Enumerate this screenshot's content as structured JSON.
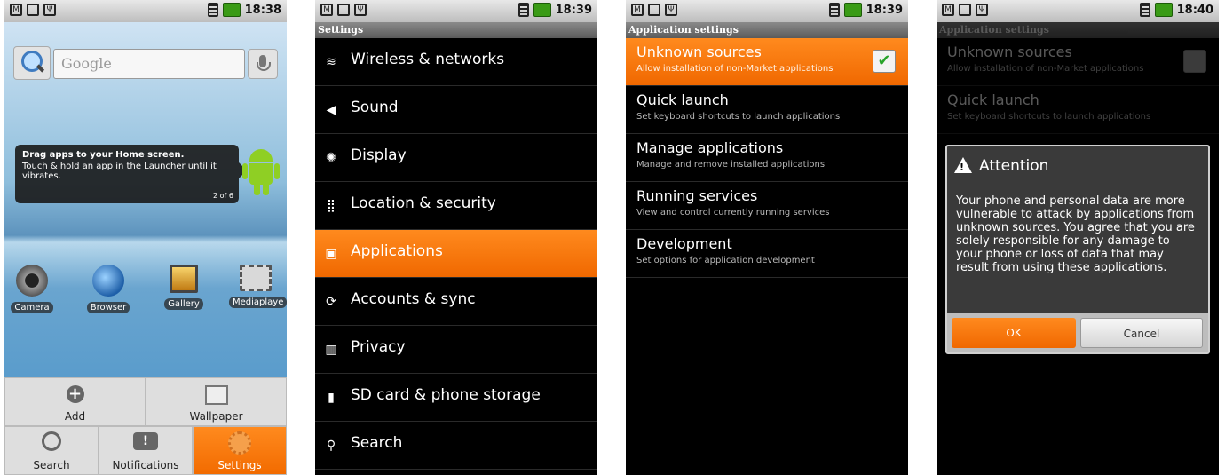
{
  "screens": [
    {
      "time": "18:38",
      "search": {
        "placeholder": "Google"
      },
      "tip": {
        "title": "Drag apps to your Home screen.",
        "body": "Touch & hold an app in the Launcher until it vibrates.",
        "page": "2 of 6"
      },
      "apps": [
        {
          "label": "Camera",
          "icon": "camera-icon"
        },
        {
          "label": "Browser",
          "icon": "globe-icon"
        },
        {
          "label": "Gallery",
          "icon": "gallery-icon"
        },
        {
          "label": "Mediaplaye",
          "icon": "film-icon"
        }
      ],
      "drawer": {
        "add": "Add",
        "wallpaper": "Wallpaper",
        "search": "Search",
        "notifications": "Notifications",
        "settings": "Settings"
      }
    },
    {
      "time": "18:39",
      "title": "Settings",
      "items": [
        {
          "label": "Wireless & networks",
          "icon": "wifi-icon",
          "glyph": "≋"
        },
        {
          "label": "Sound",
          "icon": "speaker-icon",
          "glyph": "◀"
        },
        {
          "label": "Display",
          "icon": "brightness-icon",
          "glyph": "✺"
        },
        {
          "label": "Location & security",
          "icon": "grid-icon",
          "glyph": "⣿"
        },
        {
          "label": "Applications",
          "icon": "applications-icon",
          "glyph": "▣",
          "selected": true
        },
        {
          "label": "Accounts & sync",
          "icon": "sync-icon",
          "glyph": "⟳"
        },
        {
          "label": "Privacy",
          "icon": "privacy-icon",
          "glyph": "▥"
        },
        {
          "label": "SD card & phone storage",
          "icon": "sdcard-icon",
          "glyph": "▮"
        },
        {
          "label": "Search",
          "icon": "search-icon",
          "glyph": "⚲"
        }
      ]
    },
    {
      "time": "18:39",
      "title": "Application settings",
      "items": [
        {
          "title": "Unknown sources",
          "subtitle": "Allow installation of non-Market applications",
          "checked": true
        },
        {
          "title": "Quick launch",
          "subtitle": "Set keyboard shortcuts to launch applications"
        },
        {
          "title": "Manage applications",
          "subtitle": "Manage and remove installed applications"
        },
        {
          "title": "Running services",
          "subtitle": "View and control currently running services"
        },
        {
          "title": "Development",
          "subtitle": "Set options for application development"
        }
      ],
      "checkmark": "✔"
    },
    {
      "time": "18:40",
      "title": "Application settings",
      "background_items": [
        {
          "title": "Unknown sources",
          "subtitle": "Allow installation of non-Market applications"
        },
        {
          "title": "Quick launch",
          "subtitle": "Set keyboard shortcuts to launch applications"
        }
      ],
      "dialog": {
        "title": "Attention",
        "message": "Your phone and personal data are more vulnerable to attack by applications from unknown sources. You agree that you are solely responsible for any damage to your phone or loss of data that may result from using these applications.",
        "ok": "OK",
        "cancel": "Cancel"
      }
    }
  ],
  "colors": {
    "accent": "#f57c00",
    "check": "#27a32a"
  }
}
